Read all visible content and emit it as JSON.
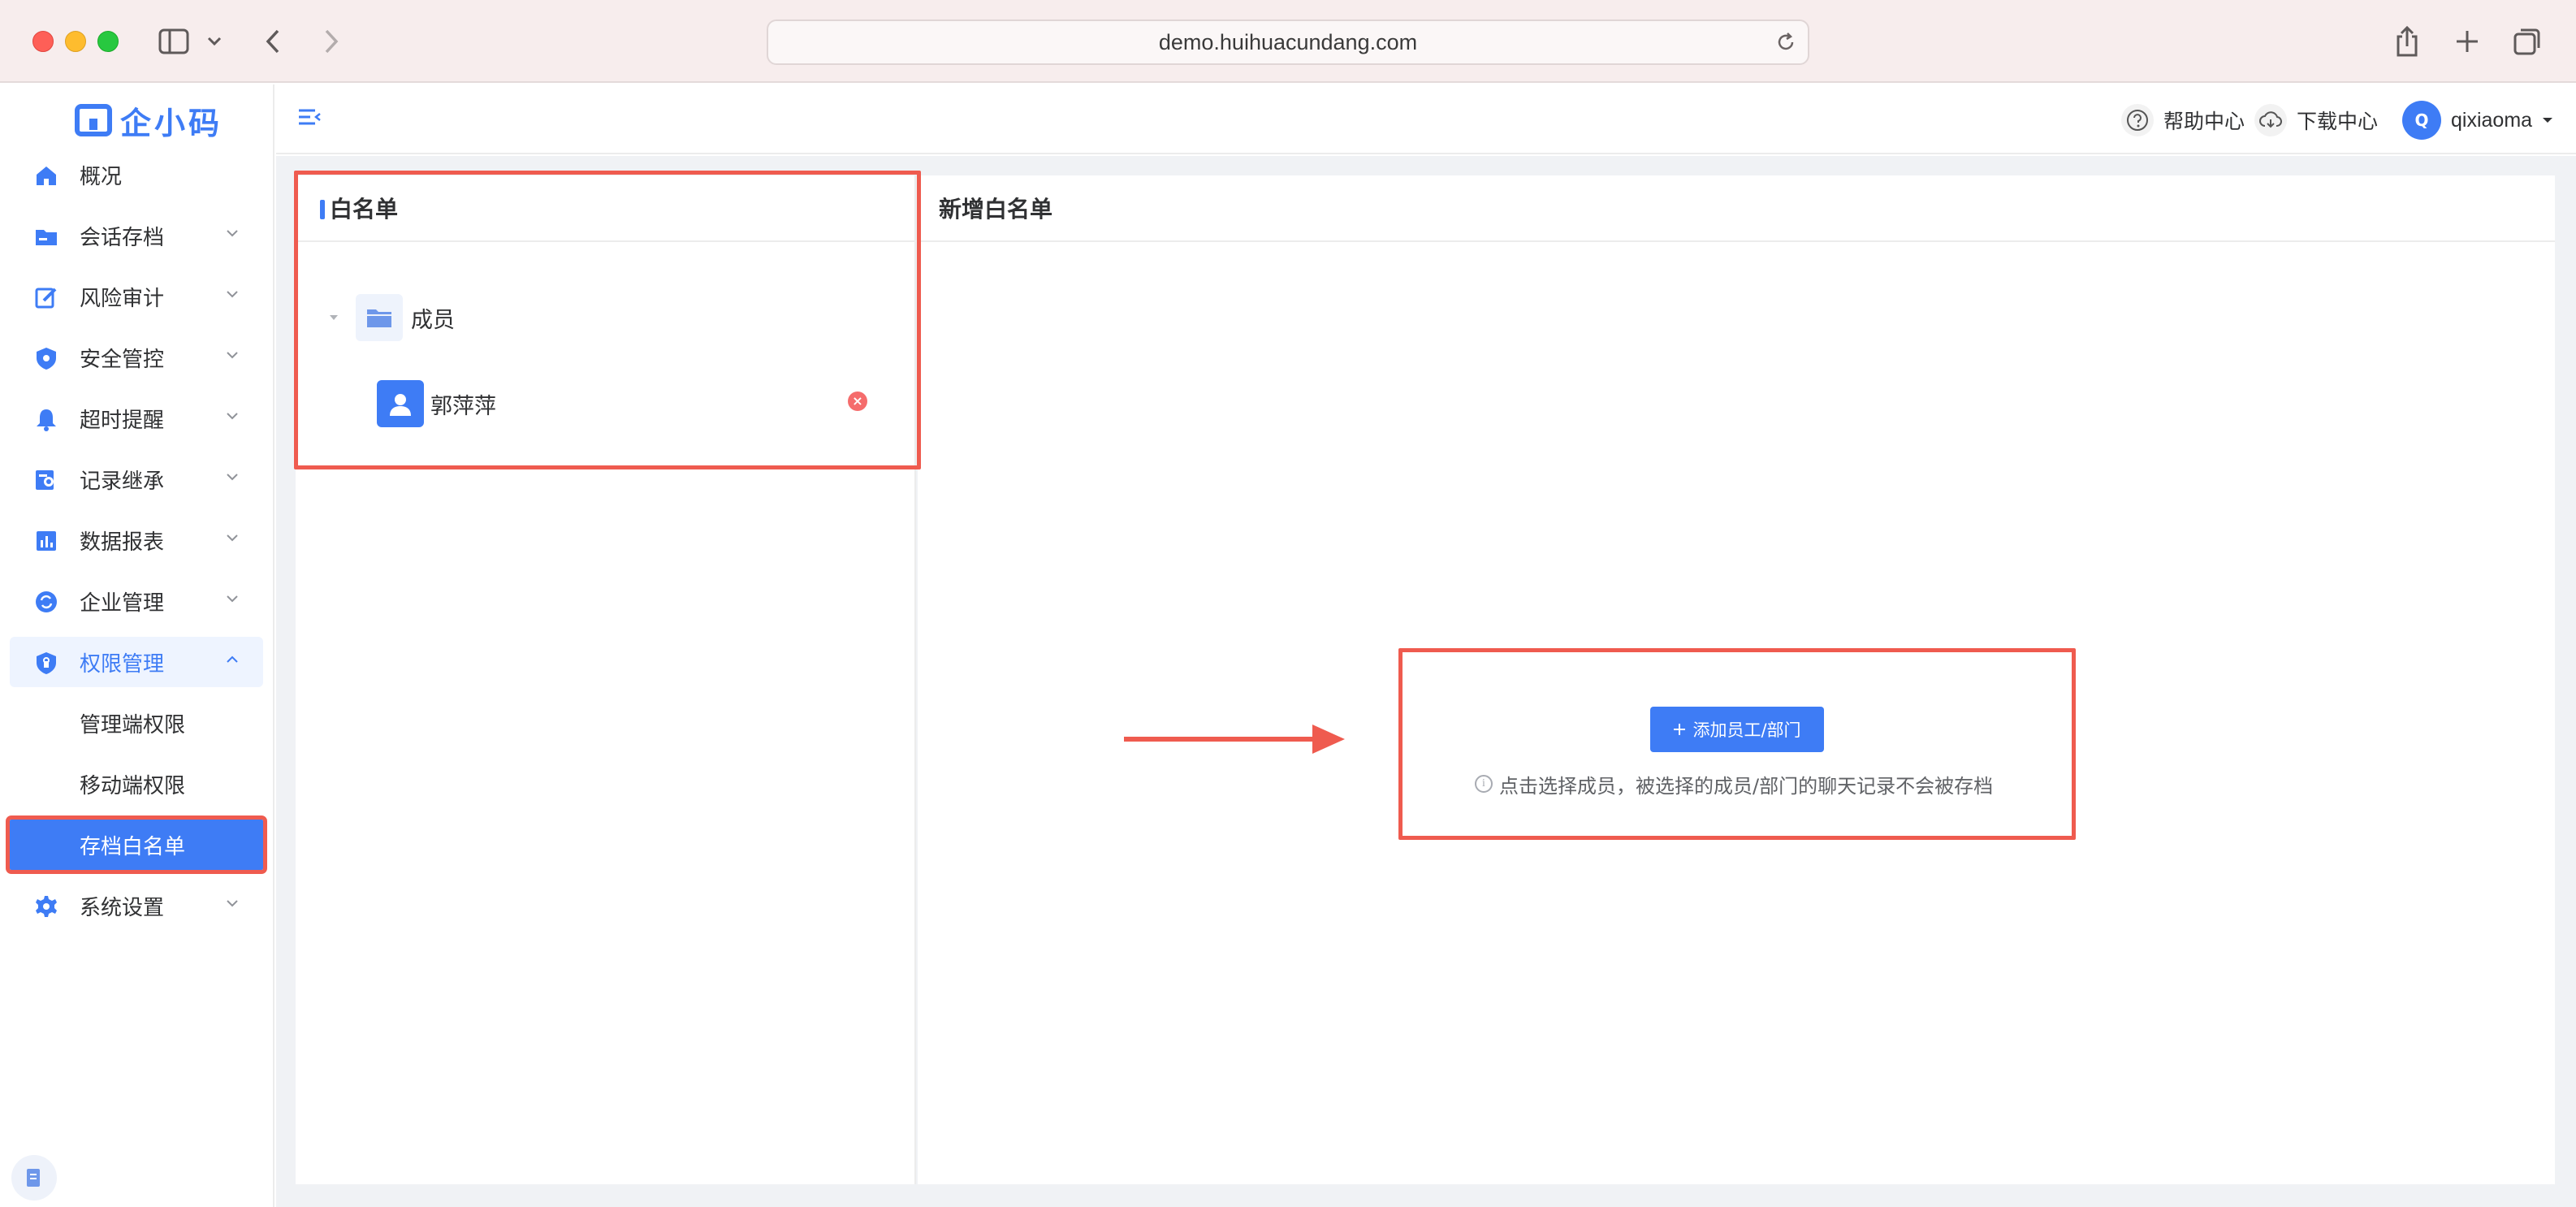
{
  "browser": {
    "url": "demo.huihuacundang.com"
  },
  "app": {
    "logo_text": "企小码"
  },
  "sidebar": {
    "items": [
      {
        "label": "概况",
        "icon": "home-icon",
        "expandable": false
      },
      {
        "label": "会话存档",
        "icon": "folder-icon",
        "expandable": true
      },
      {
        "label": "风险审计",
        "icon": "edit-icon",
        "expandable": true
      },
      {
        "label": "安全管控",
        "icon": "shield-icon",
        "expandable": true
      },
      {
        "label": "超时提醒",
        "icon": "bell-icon",
        "expandable": true
      },
      {
        "label": "记录继承",
        "icon": "user-record-icon",
        "expandable": true
      },
      {
        "label": "数据报表",
        "icon": "bar-chart-icon",
        "expandable": true
      },
      {
        "label": "企业管理",
        "icon": "sync-icon",
        "expandable": true
      },
      {
        "label": "权限管理",
        "icon": "lock-shield-icon",
        "expandable": true,
        "open": true
      },
      {
        "label": "系统设置",
        "icon": "gear-icon",
        "expandable": true
      }
    ],
    "sub_items": [
      {
        "label": "管理端权限"
      },
      {
        "label": "移动端权限"
      },
      {
        "label": "存档白名单",
        "active": true
      }
    ]
  },
  "header": {
    "help_label": "帮助中心",
    "download_label": "下载中心",
    "avatar_letter": "Q",
    "user_name": "qixiaoma"
  },
  "whitelist_panel": {
    "title": "白名单",
    "group_label": "成员",
    "members": [
      {
        "name": "郭萍萍"
      }
    ]
  },
  "add_panel": {
    "title": "新增白名单",
    "add_button_label": "添加员工/部门",
    "hint": "点击选择成员，被选择的成员/部门的聊天记录不会被存档"
  },
  "colors": {
    "accent": "#3e7cf5",
    "highlight_red": "#ef5b4f",
    "remove_red": "#f56c6c"
  }
}
